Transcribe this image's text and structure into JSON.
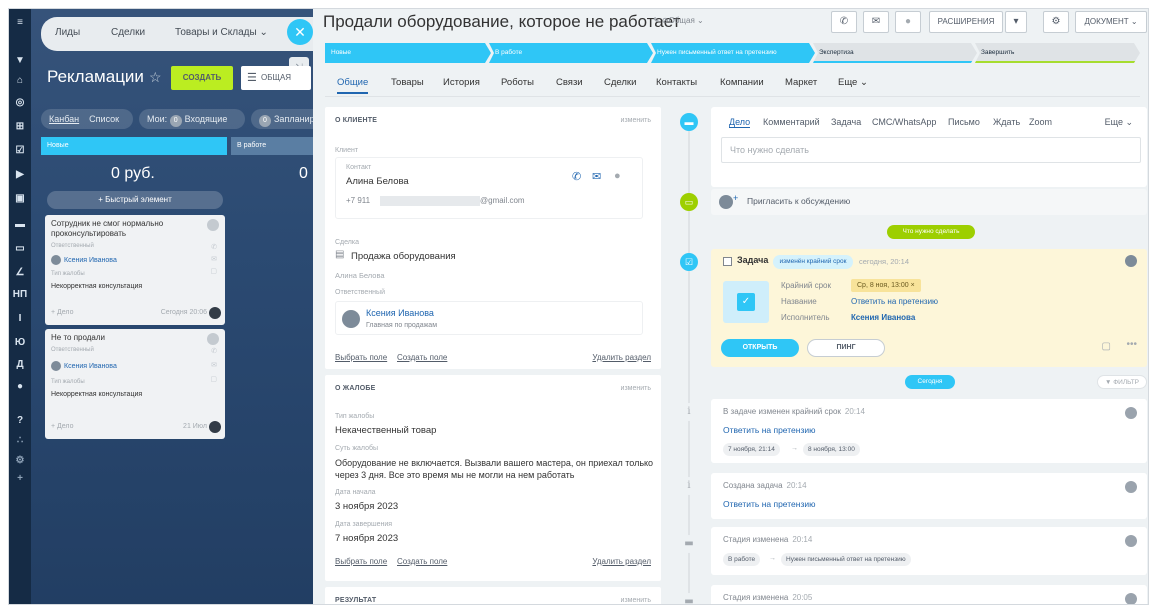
{
  "rail": {
    "icons": [
      "menu-icon",
      "filter-funnel-icon",
      "home-icon",
      "target-icon",
      "cart-icon",
      "checkbox-icon",
      "tag-icon",
      "scan-icon",
      "briefcase-icon",
      "inbox-icon",
      "pen-icon",
      "np-icon",
      "rail-i-icon",
      "rail-yu-icon",
      "rail-d-icon",
      "record-icon",
      "help-icon",
      "sitemap-icon",
      "settings-icon",
      "add-icon"
    ],
    "np_label": "НП",
    "i_label": "I",
    "yu_label": "Ю",
    "d_label": "Д"
  },
  "background": {
    "top_tabs": [
      "Лиды",
      "Сделки",
      "Товары и Склады ⌄"
    ],
    "close_symbol": "✕",
    "title": "Рекламации",
    "star": "☆",
    "create_label": "СОЗДАТЬ",
    "filter_label": "ОБЩАЯ",
    "views": {
      "kanban": "Канбан",
      "list": "Список",
      "mine": "Мои:",
      "mine_count": "0",
      "incoming": "Входящие",
      "planned_count": "0",
      "planned": "Запланир"
    },
    "columns": [
      {
        "title": "Новые",
        "sum": "0 руб."
      },
      {
        "title": "В работе",
        "sum": "0"
      }
    ],
    "quick_add": "+ Быстрый элемент",
    "cards": [
      {
        "title": "Сотрудник не смог нормально проконсультировать",
        "resp_label": "Ответственный",
        "person": "Ксения Иванова",
        "type_label": "Тип жалобы",
        "type_value": "Некорректная консультация",
        "add_case": "+ Дело",
        "date": "Сегодня 20:06"
      },
      {
        "title": "Не то продали",
        "resp_label": "Ответственный",
        "person": "Ксения Иванова",
        "type_label": "Тип жалобы",
        "type_value": "Некорректная консультация",
        "add_case": "+ Дело",
        "date": "21 Июл"
      }
    ]
  },
  "header": {
    "title": "Продали оборудование, которое не работает",
    "edit_tag": "✎ ⊘Общая ⌄",
    "buttons": {
      "phone": "✆",
      "mail": "✉",
      "more": "●",
      "extensions": "РАСШИРЕНИЯ",
      "ext_dropdown": "▾",
      "settings": "⚙",
      "document": "ДОКУМЕНТ ⌄"
    }
  },
  "stages": [
    "Новые",
    "В работе",
    "Нужен письменный ответ на претензию",
    "Экспертиза",
    "Завершить"
  ],
  "tabs": [
    "Общие",
    "Товары",
    "История",
    "Роботы",
    "Связи",
    "Сделки",
    "Контакты",
    "Компании",
    "Маркет",
    "Еще ⌄"
  ],
  "client_block": {
    "head": "О КЛИЕНТЕ",
    "edit": "изменить",
    "client_label": "Клиент",
    "contact_label": "Контакт",
    "contact_name": "Алина Белова",
    "phone": "+7 911",
    "email": "@gmail.com",
    "deal_label": "Сделка",
    "deal_value": "Продажа оборудования",
    "deal_sub": "Алина Белова",
    "resp_label": "Ответственный",
    "resp_name": "Ксения Иванова",
    "resp_role": "Главная по продажам",
    "select_field": "Выбрать поле",
    "create_field": "Создать поле",
    "delete_section": "Удалить раздел"
  },
  "complaint_block": {
    "head": "О ЖАЛОБЕ",
    "edit": "изменить",
    "type_label": "Тип жалобы",
    "type_value": "Некачественный товар",
    "essence_label": "Суть жалобы",
    "essence_value": "Оборудование не включается. Вызвали вашего мастера, он приехал только через 3 дня. Все это время мы не могли на нем работать",
    "start_label": "Дата начала",
    "start_value": "3 ноября 2023",
    "end_label": "Дата завершения",
    "end_value": "7 ноября 2023",
    "select_field": "Выбрать поле",
    "create_field": "Создать поле",
    "delete_section": "Удалить раздел"
  },
  "result_block": {
    "head": "РЕЗУЛЬТАТ",
    "edit": "изменить"
  },
  "activity": {
    "tabs": [
      "Дело",
      "Комментарий",
      "Задача",
      "СМС/WhatsApp",
      "Письмо",
      "Ждать",
      "Zoom"
    ],
    "more": "Еще ⌄",
    "placeholder": "Что нужно сделать",
    "invite": "Пригласить к обсуждению",
    "todo_badge": "Что нужно сделать"
  },
  "task": {
    "label": "Задача",
    "badge": "изменён крайний срок",
    "time": "сегодня, 20:14",
    "deadline_label": "Крайний срок",
    "deadline_value": "Ср, 8 ноя, 13:00 ×",
    "name_label": "Название",
    "name_value": "Ответить на претензию",
    "exec_label": "Исполнитель",
    "exec_value": "Ксения Иванова",
    "open_btn": "ОТКРЫТЬ",
    "ping_btn": "ПИНГ"
  },
  "today_badge": "Сегодня",
  "filter_label": "ФИЛЬТР",
  "history": [
    {
      "title": "В задаче изменен крайний срок",
      "time": "20:14",
      "link": "Ответить на претензию",
      "from": "7 ноября, 21:14",
      "to": "8 ноября, 13:00"
    },
    {
      "title": "Создана задача",
      "time": "20:14",
      "link": "Ответить на претензию"
    },
    {
      "title": "Стадия изменена",
      "time": "20:14",
      "from": "В работе",
      "to": "Нужен письменный ответ на претензию"
    },
    {
      "title": "Стадия изменена",
      "time": "20:05"
    }
  ],
  "colors": {
    "accent": "#2fc6f6",
    "green": "#bbed21",
    "link": "#2066b0",
    "task_bg": "#fdf6d9"
  }
}
